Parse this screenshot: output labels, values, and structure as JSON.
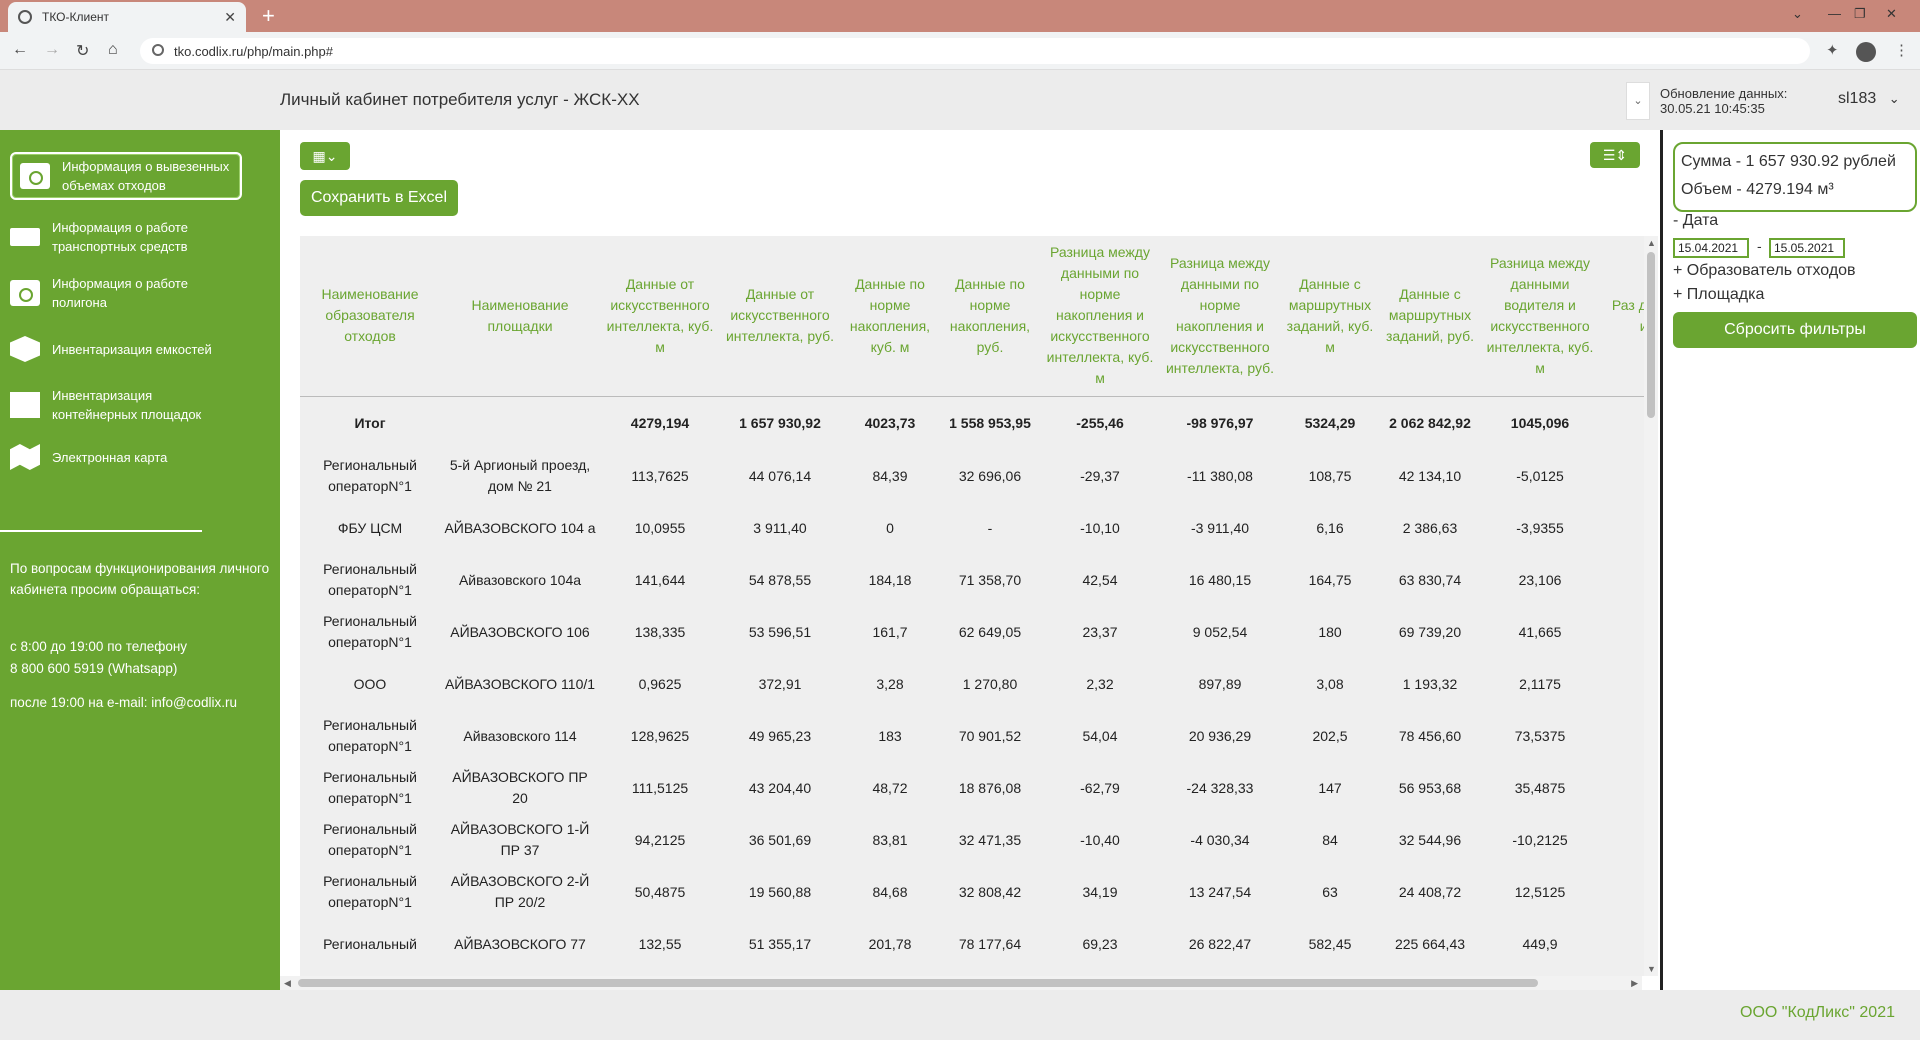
{
  "browser": {
    "tab_title": "ТКО-Клиент",
    "url": "tko.codlix.ru/php/main.php#",
    "new_tab": "+",
    "tab_close": "✕",
    "back": "←",
    "forward": "→",
    "reload": "↻",
    "home": "⌂",
    "minimize": "⌄",
    "min2": "—",
    "restore": "❐",
    "close": "✕",
    "menu": "⋮",
    "extensions": "✦"
  },
  "header": {
    "title": "Личный кабинет потребителя услуг - ЖСК-ХХ",
    "update_label": "Обновление данных:",
    "update_time": "30.05.21 10:45:35",
    "user": "sl183",
    "user_chevron": "⌄",
    "dropdown_icon": "⌄"
  },
  "sidebar": {
    "items": [
      {
        "label": "Информация о вывезенных объемах отходов",
        "icon": "folder-icon"
      },
      {
        "label": "Информация о работе транспортных средств",
        "icon": "truck-icon"
      },
      {
        "label": "Информация о работе полигона",
        "icon": "folder-icon"
      },
      {
        "label": "Инвентаризация емкостей",
        "icon": "box-icon"
      },
      {
        "label": "Инвентаризация контейнерных площадок",
        "icon": "bin-icon"
      },
      {
        "label": "Электронная карта",
        "icon": "map-icon"
      }
    ],
    "contact_intro": "По вопросам функционирования личного кабинета просим обращаться:",
    "contact_phone_1": "с 8:00 до 19:00 по телефону",
    "contact_phone_2": "8 800 600 5919 (Whatsapp)",
    "contact_email": "после 19:00 на e-mail: info@codlix.ru"
  },
  "toolbar": {
    "grid_button": "▦⌄",
    "save_excel": "Сохранить в Excel",
    "list_button": "☰⇕"
  },
  "table": {
    "headers": [
      "Наименование образователя отходов",
      "Наименование площадки",
      "Данные от искусственного интеллекта, куб. м",
      "Данные от искусственного интеллекта, руб.",
      "Данные по норме накопления, куб. м",
      "Данные по норме накопления, руб.",
      "Разница между данными по норме накопления и искусственного интеллекта, куб. м",
      "Разница между данными по норме накопления и искусственного интеллекта, руб.",
      "Данные с маршрутных заданий, куб. м",
      "Данные с маршрутных заданий, руб.",
      "Разница между данными водителя и искусственного интеллекта, куб. м",
      "Раз д в иск ин"
    ],
    "total": [
      "Итог",
      "",
      "4279,194",
      "1 657 930,92",
      "4023,73",
      "1 558 953,95",
      "-255,46",
      "-98 976,97",
      "5324,29",
      "2 062 842,92",
      "1045,096",
      ""
    ],
    "rows": [
      [
        "Региональный операторN°1",
        "5-й Аргионый проезд, дом № 21",
        "113,7625",
        "44 076,14",
        "84,39",
        "32 696,06",
        "-29,37",
        "-11 380,08",
        "108,75",
        "42 134,10",
        "-5,0125",
        ""
      ],
      [
        "ФБУ ЦСМ",
        "АЙВАЗОВСКОГО 104 а",
        "10,0955",
        "3 911,40",
        "0",
        "-",
        "-10,10",
        "-3 911,40",
        "6,16",
        "2 386,63",
        "-3,9355",
        ""
      ],
      [
        "Региональный операторN°1",
        "Айвазовского 104а",
        "141,644",
        "54 878,55",
        "184,18",
        "71 358,70",
        "42,54",
        "16 480,15",
        "164,75",
        "63 830,74",
        "23,106",
        ""
      ],
      [
        "Региональный операторN°1",
        "АЙВАЗОВСКОГО 106",
        "138,335",
        "53 596,51",
        "161,7",
        "62 649,05",
        "23,37",
        "9 052,54",
        "180",
        "69 739,20",
        "41,665",
        ""
      ],
      [
        "ООО",
        "АЙВАЗОВСКОГО 110/1",
        "0,9625",
        "372,91",
        "3,28",
        "1 270,80",
        "2,32",
        "897,89",
        "3,08",
        "1 193,32",
        "2,1175",
        ""
      ],
      [
        "Региональный операторN°1",
        "Айвазовского 114",
        "128,9625",
        "49 965,23",
        "183",
        "70 901,52",
        "54,04",
        "20 936,29",
        "202,5",
        "78 456,60",
        "73,5375",
        ""
      ],
      [
        "Региональный операторN°1",
        "АЙВАЗОВСКОГО ПР 20",
        "111,5125",
        "43 204,40",
        "48,72",
        "18 876,08",
        "-62,79",
        "-24 328,33",
        "147",
        "56 953,68",
        "35,4875",
        ""
      ],
      [
        "Региональный операторN°1",
        "АЙВАЗОВСКОГО 1-Й ПР 37",
        "94,2125",
        "36 501,69",
        "83,81",
        "32 471,35",
        "-10,40",
        "-4 030,34",
        "84",
        "32 544,96",
        "-10,2125",
        ""
      ],
      [
        "Региональный операторN°1",
        "АЙВАЗОВСКОГО 2-Й ПР 20/2",
        "50,4875",
        "19 560,88",
        "84,68",
        "32 808,42",
        "34,19",
        "13 247,54",
        "63",
        "24 408,72",
        "12,5125",
        ""
      ],
      [
        "Региональный",
        "АЙВАЗОВСКОГО 77",
        "132,55",
        "51 355,17",
        "201,78",
        "78 177,64",
        "69,23",
        "26 822,47",
        "582,45",
        "225 664,43",
        "449,9",
        ""
      ]
    ]
  },
  "filters": {
    "sum_line": "Сумма - 1 657 930.92 рублей",
    "volume_line": "Объем - 4279.194 м³",
    "date_label": "- Дата",
    "date_from": "15.04.2021",
    "date_sep": "-",
    "date_to": "15.05.2021",
    "producer_label": "+ Образователь отходов",
    "site_label": "+ Площадка",
    "reset": "Сбросить фильтры"
  },
  "footer": {
    "company": "ООО \"КодЛикс\" 2021"
  },
  "colors": {
    "accent": "#6aa531",
    "tabbar": "#c8877a"
  }
}
